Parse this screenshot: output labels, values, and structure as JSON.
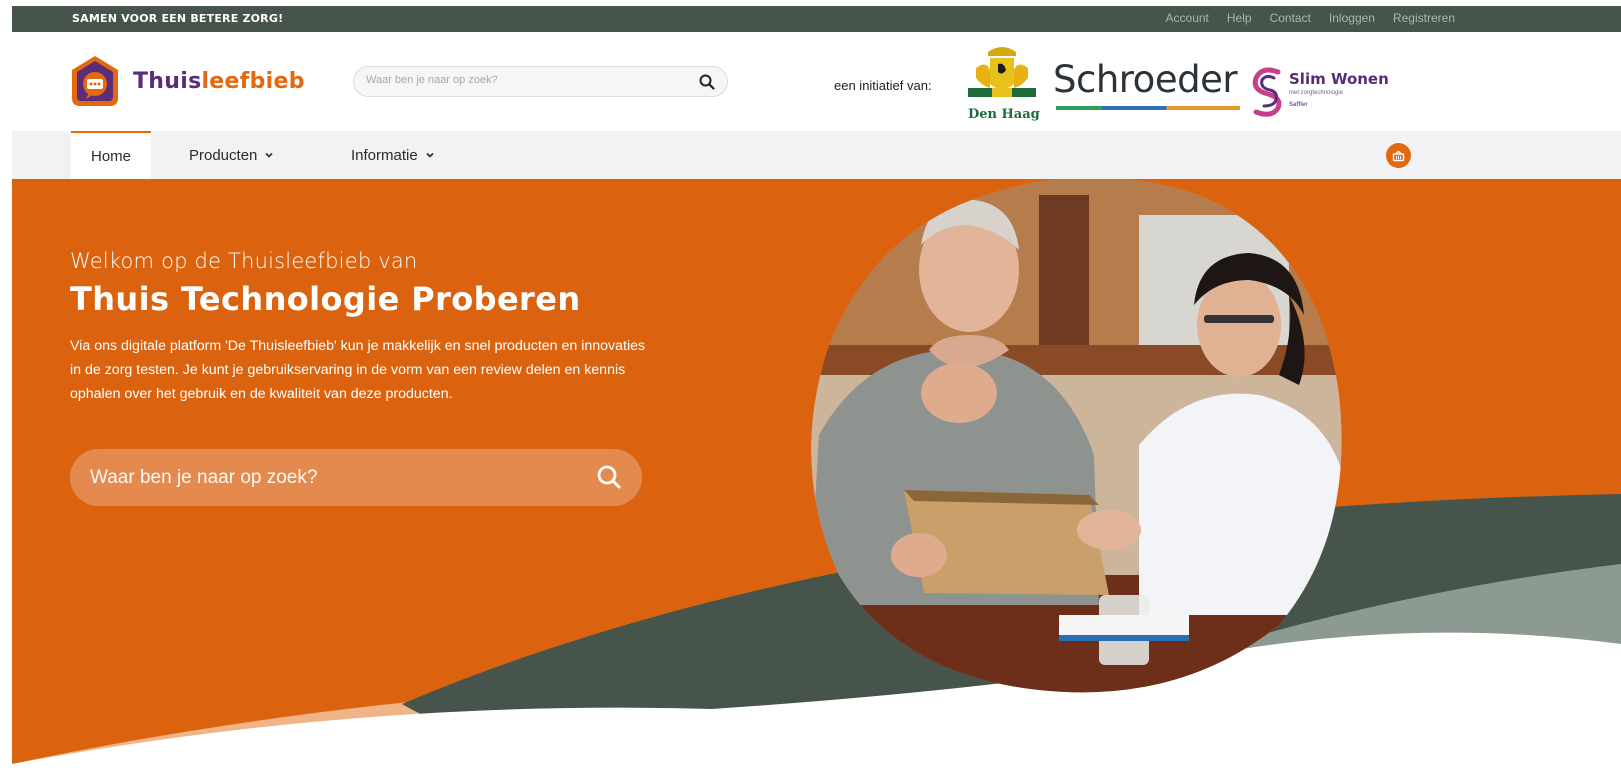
{
  "topbar": {
    "slogan": "SAMEN VOOR EEN BETERE ZORG!",
    "links": [
      "Account",
      "Help",
      "Contact",
      "Inloggen",
      "Registreren"
    ]
  },
  "header": {
    "logo_part1": "Thuis",
    "logo_part2": "leefbieb",
    "search_placeholder": "Waar ben je naar op zoek?",
    "initiative_label": "een initiatief van:",
    "partners": {
      "den_haag": "Den Haag",
      "schroeder": "Schroeder",
      "slim_wonen": "Slim Wonen",
      "slim_wonen_sub": "met zorgtechnologie",
      "slim_wonen_by": "Saffier"
    }
  },
  "nav": {
    "items": [
      "Home",
      "Producten",
      "Informatie"
    ]
  },
  "hero": {
    "subtitle": "Welkom op de Thuisleefbieb van",
    "title": "Thuis Technologie Proberen",
    "text": "Via ons digitale platform 'De Thuisleefbieb' kun je makkelijk en snel producten en innovaties in de zorg testen. Je kunt je gebruikservaring in de vorm van een review delen en kennis ophalen over het gebruik en de kwaliteit van deze producten.",
    "search_placeholder": "Waar ben je naar op zoek?"
  },
  "colors": {
    "brand_orange": "#db630f",
    "dark_green": "#46544c",
    "purple": "#5b2d79"
  }
}
